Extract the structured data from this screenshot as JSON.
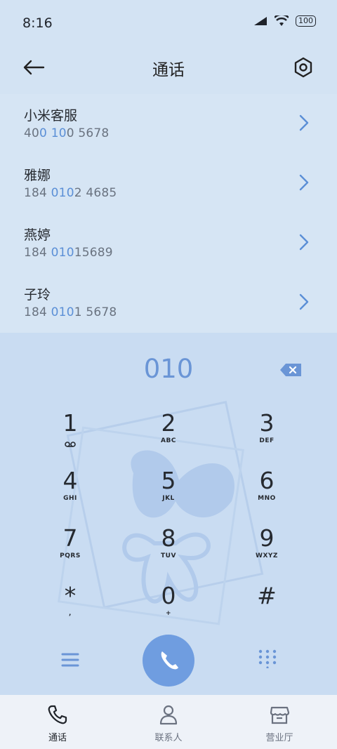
{
  "status_bar": {
    "time": "8:16",
    "battery_text": "100"
  },
  "header": {
    "title": "通话"
  },
  "contacts": [
    {
      "name": "小米客服",
      "number_parts": [
        "40",
        "0",
        " ",
        "10",
        "0 5678"
      ]
    },
    {
      "name": "雅娜",
      "number_parts": [
        "184 ",
        "010",
        "2 4685"
      ]
    },
    {
      "name": "燕婷",
      "number_parts": [
        "184 ",
        "010",
        "15689"
      ]
    },
    {
      "name": "子玲",
      "number_parts": [
        "184 ",
        "010",
        "1 5678"
      ]
    }
  ],
  "dialer": {
    "input": "010"
  },
  "keys": [
    {
      "digit": "1",
      "letters": ""
    },
    {
      "digit": "2",
      "letters": "ABC"
    },
    {
      "digit": "3",
      "letters": "DEF"
    },
    {
      "digit": "4",
      "letters": "GHI"
    },
    {
      "digit": "5",
      "letters": "JKL"
    },
    {
      "digit": "6",
      "letters": "MNO"
    },
    {
      "digit": "7",
      "letters": "PQRS"
    },
    {
      "digit": "8",
      "letters": "TUV"
    },
    {
      "digit": "9",
      "letters": "WXYZ"
    },
    {
      "digit": "*",
      "letters": ","
    },
    {
      "digit": "0",
      "letters": "+"
    },
    {
      "digit": "#",
      "letters": ""
    }
  ],
  "bottom_nav": [
    {
      "label": "通话",
      "icon": "phone-icon",
      "active": true
    },
    {
      "label": "联系人",
      "icon": "person-icon",
      "active": false
    },
    {
      "label": "营业厅",
      "icon": "store-icon",
      "active": false
    }
  ],
  "colors": {
    "accent": "#6f9de0",
    "highlight": "#5b8fd6",
    "background": "#d3e3f3"
  }
}
